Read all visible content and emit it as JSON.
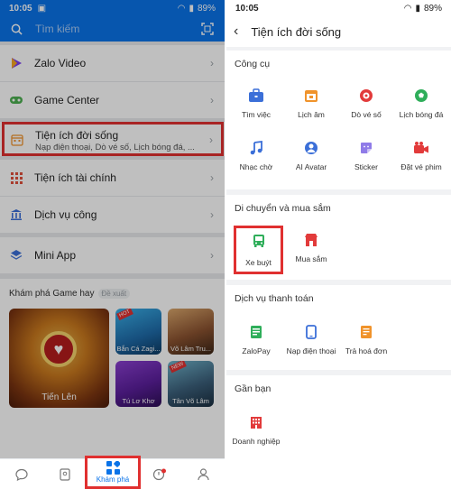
{
  "left": {
    "status": {
      "time": "10:05",
      "battery": "89%"
    },
    "search": {
      "placeholder": "Tìm kiếm"
    },
    "menu": [
      {
        "label": "Zalo Video",
        "icon": "video-play-icon"
      },
      {
        "label": "Game Center",
        "icon": "gamepad-icon"
      },
      {
        "label": "Tiện ích tài chính",
        "icon": "grid-icon"
      },
      {
        "label": "Dịch vụ công",
        "icon": "government-building-icon"
      },
      {
        "label": "Mini App",
        "icon": "layers-icon"
      }
    ],
    "highlighted_item": {
      "label": "Tiện ích đời sống",
      "subtitle": "Nạp điện thoại, Dò vé số, Lịch bóng đá, ...",
      "icon": "calendar-icon"
    },
    "games": {
      "title": "Khám phá Game hay",
      "tag": "Đề xuất",
      "big": {
        "name": "Tiến Lên"
      },
      "small": [
        {
          "name": "Bắn Cá Zagi...",
          "badge": "HOT"
        },
        {
          "name": "Võ Lâm Tru..."
        },
        {
          "name": "Tú Lơ Khơ"
        },
        {
          "name": "Tân Võ Lâm",
          "badge": "NEW"
        }
      ]
    },
    "bottom_nav": {
      "active_label": "Khám phá"
    }
  },
  "right": {
    "status": {
      "time": "10:05",
      "battery": "89%"
    },
    "header": {
      "title": "Tiện ích đời sống"
    },
    "sections": {
      "cong_cu": {
        "title": "Công cụ",
        "items": [
          {
            "label": "Tìm việc",
            "icon": "briefcase-icon"
          },
          {
            "label": "Lịch âm",
            "icon": "calendar-icon"
          },
          {
            "label": "Dò vé số",
            "icon": "lottery-ball-icon"
          },
          {
            "label": "Lịch bóng đá",
            "icon": "soccer-ball-icon"
          },
          {
            "label": "Nhạc chờ",
            "icon": "music-note-icon"
          },
          {
            "label": "AI Avatar",
            "icon": "avatar-icon"
          },
          {
            "label": "Sticker",
            "icon": "sticker-icon"
          },
          {
            "label": "Đặt vé phim",
            "icon": "movie-camera-icon"
          }
        ]
      },
      "di_chuyen": {
        "title": "Di chuyển và mua sắm",
        "items": [
          {
            "label": "Xe buýt",
            "icon": "bus-icon"
          },
          {
            "label": "Mua sắm",
            "icon": "store-icon"
          }
        ]
      },
      "thanh_toan": {
        "title": "Dịch vụ thanh toán",
        "items": [
          {
            "label": "ZaloPay",
            "icon": "wallet-icon"
          },
          {
            "label": "Nạp điện thoại",
            "icon": "phone-icon"
          },
          {
            "label": "Trả hoá đơn",
            "icon": "bill-icon"
          }
        ]
      },
      "gan_ban": {
        "title": "Gần bạn",
        "items": [
          {
            "label": "Doanh nghiệp",
            "icon": "building-icon"
          }
        ]
      }
    }
  }
}
